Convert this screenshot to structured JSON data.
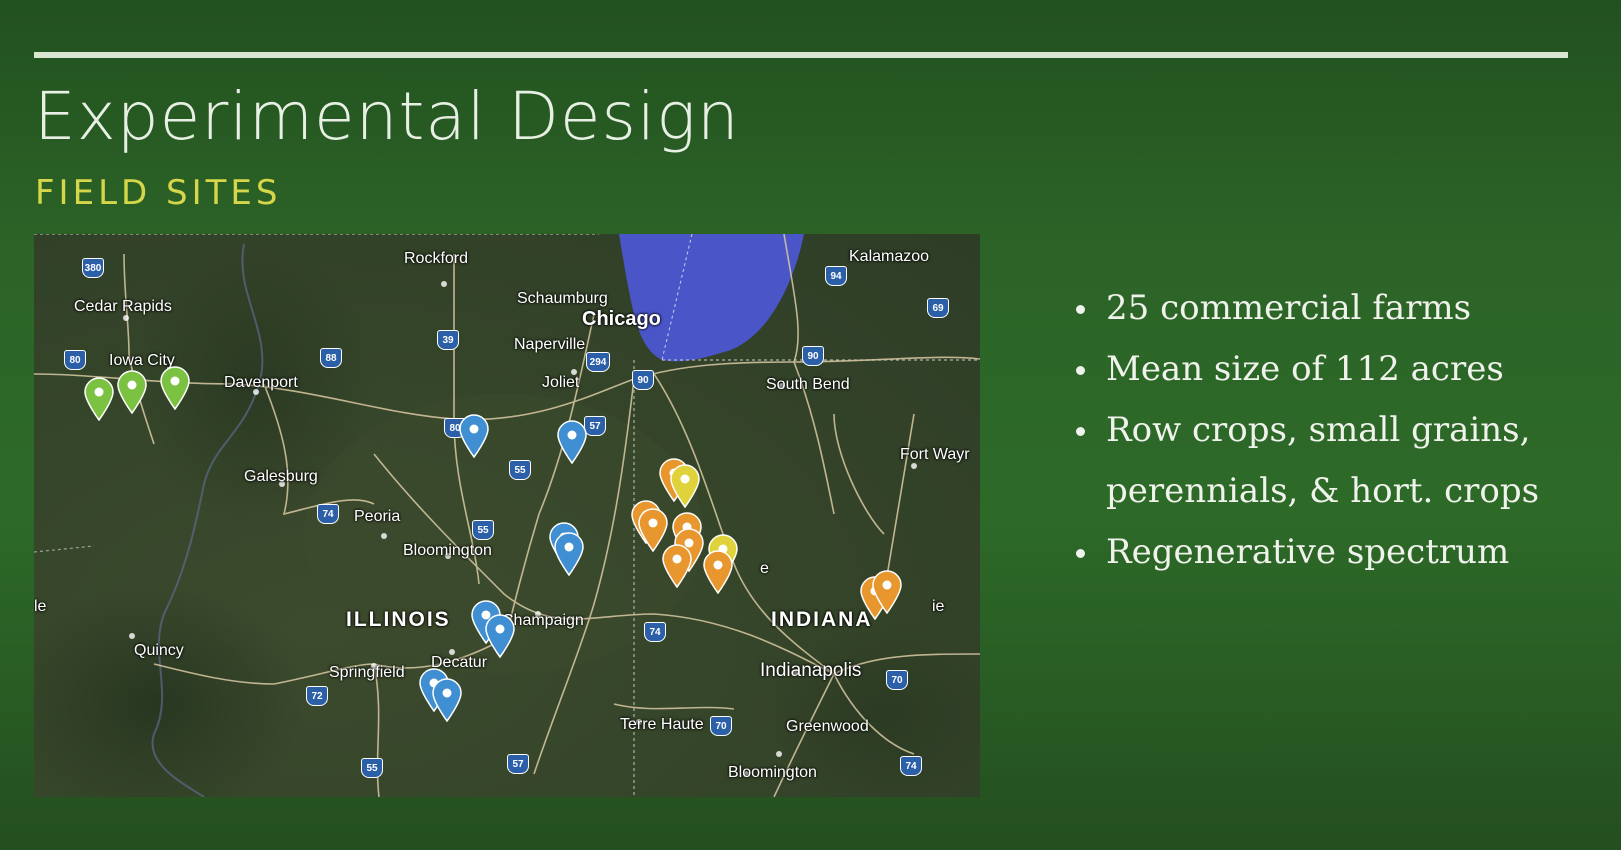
{
  "slide": {
    "title": "Experimental Design",
    "subtitle": "FIELD SITES",
    "bullets": [
      "25 commercial farms",
      "Mean size of 112 acres",
      "Row crops, small grains,",
      "perennials, & hort. crops",
      "Regenerative spectrum"
    ]
  },
  "map": {
    "cities": {
      "rockford": "Rockford",
      "kalamazoo": "Kalamazoo",
      "cedar_rapids": "Cedar Rapids",
      "schaumburg": "Schaumburg",
      "chicago": "Chicago",
      "naperville": "Naperville",
      "iowa_city": "Iowa City",
      "davenport": "Davenport",
      "joliet": "Joliet",
      "south_bend": "South Bend",
      "fort_wayne": "Fort Wayr",
      "galesburg": "Galesburg",
      "peoria": "Peoria",
      "bloomington_il": "Bloomington",
      "champaign": "Champaign",
      "quincy": "Quincy",
      "springfield": "Springfield",
      "decatur": "Decatur",
      "indianapolis": "Indianapolis",
      "terre_haute": "Terre Haute",
      "greenwood": "Greenwood",
      "bloomington_in": "Bloomington",
      "edge_left": "le",
      "edge_right": "ie",
      "edge_mid": "e"
    },
    "states": {
      "illinois": "ILLINOIS",
      "indiana": "INDIANA"
    },
    "highways": [
      "380",
      "94",
      "69",
      "80",
      "88",
      "39",
      "294",
      "90",
      "90",
      "80",
      "57",
      "55",
      "74",
      "55",
      "74",
      "72",
      "70",
      "70",
      "57",
      "55",
      "74"
    ],
    "pin_colors": {
      "green": "#7cc242",
      "blue": "#3f8fd2",
      "orange": "#e8962e",
      "yellow": "#e0d23a"
    },
    "lake_color": "#4a55c8"
  }
}
